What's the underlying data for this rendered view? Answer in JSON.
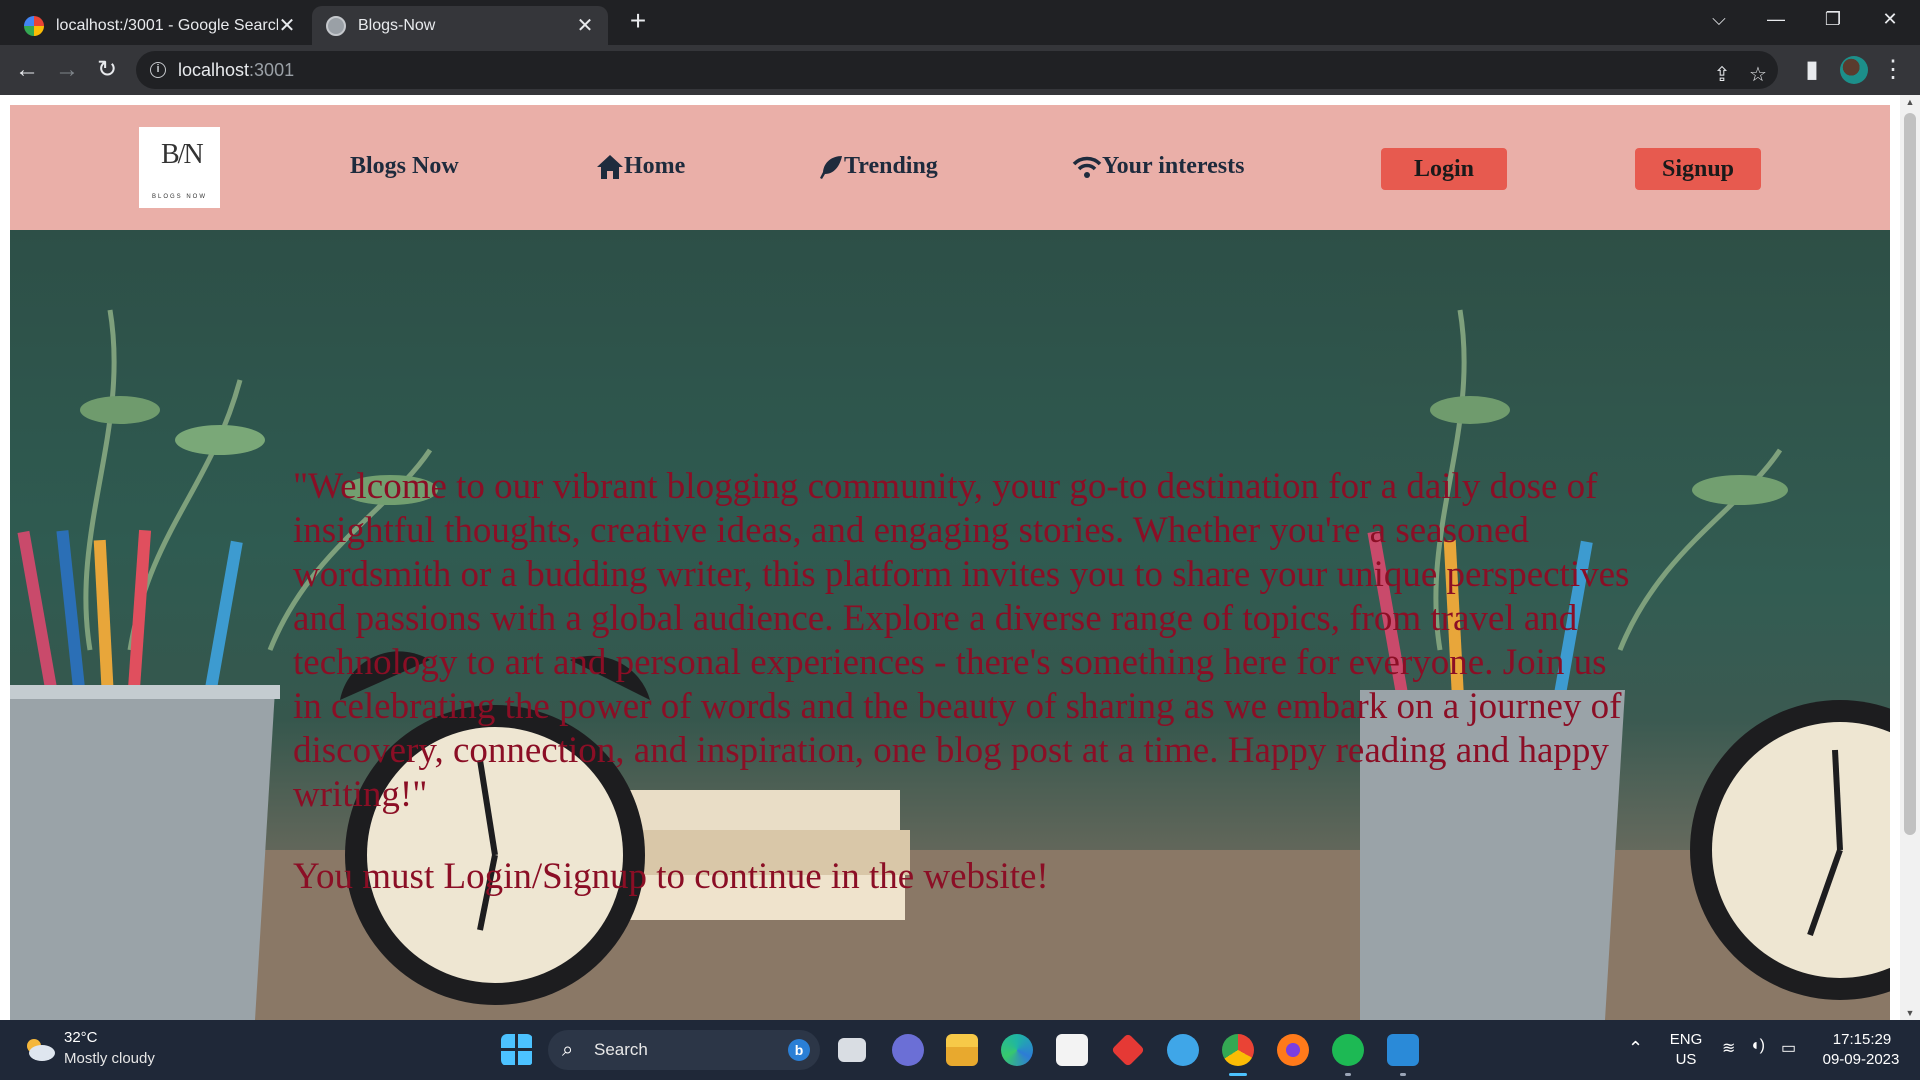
{
  "browser": {
    "tabs": [
      {
        "title": "localhost:/3001 - Google Search",
        "active": false
      },
      {
        "title": "Blogs-Now",
        "active": true
      }
    ],
    "url_host": "localhost",
    "url_port": ":3001",
    "icons": {
      "back": "arrow-left-icon",
      "forward": "arrow-right-icon",
      "reload": "reload-icon",
      "share": "share-icon",
      "bookmark": "star-icon",
      "sidepanel": "side-panel-icon",
      "menu": "kebab-menu-icon"
    }
  },
  "site": {
    "logo_text": "B/N",
    "logo_sub": "BLOGS NOW",
    "brand": "Blogs Now",
    "nav": {
      "home": "Home",
      "trending": "Trending",
      "interests": "Your interests"
    },
    "buttons": {
      "login": "Login",
      "signup": "Signup"
    },
    "colors": {
      "header_bg": "#eaafa8",
      "button_bg": "#e75a4f",
      "hero_text": "#8b0e25"
    }
  },
  "hero": {
    "welcome": "\"Welcome to our vibrant blogging community, your go-to destination for a daily dose of insightful thoughts, creative ideas, and engaging stories. Whether you're a seasoned wordsmith or a budding writer, this platform invites you to share your unique perspectives and passions with a global audience. Explore a diverse range of topics, from travel and technology to art and personal experiences - there's something here for everyone. Join us in celebrating the power of words and the beauty of sharing as we embark on a journey of discovery, connection, and inspiration, one blog post at a time. Happy reading and happy writing!\"",
    "notice": "You must Login/Signup to continue in the website!"
  },
  "taskbar": {
    "temperature": "32°C",
    "condition": "Mostly cloudy",
    "search_label": "Search",
    "lang": "ENG",
    "region": "US",
    "time": "17:15:29",
    "date": "09-09-2023"
  }
}
